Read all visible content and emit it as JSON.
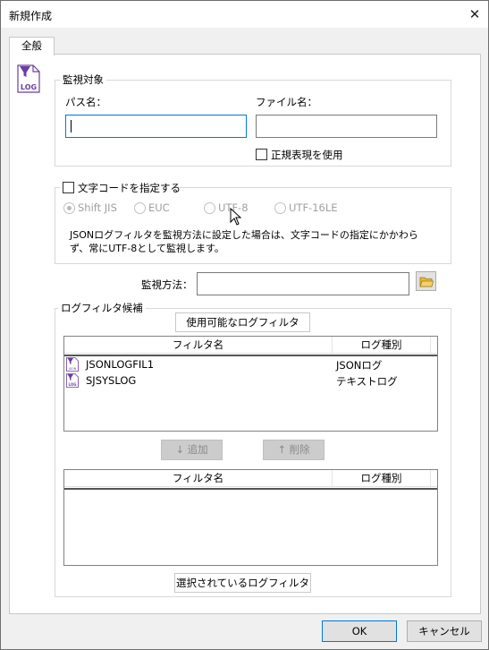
{
  "window": {
    "title": "新規作成",
    "close_glyph": "✕"
  },
  "tabs": [
    {
      "label": "全般"
    }
  ],
  "icon_label": "LOG",
  "small_icon_label": "JSON",
  "monitor_target": {
    "legend": "監視対象",
    "path_label": "パス名：",
    "path_value": "",
    "file_label": "ファイル名：",
    "file_value": "",
    "regex_label": "正規表現を使用",
    "regex_checked": false
  },
  "encoding": {
    "checkbox_label": "文字コードを指定する",
    "checked": false,
    "options": [
      "Shift JIS",
      "EUC",
      "UTF-8",
      "UTF-16LE"
    ],
    "selected": "Shift JIS",
    "note": "JSONログフィルタを監視方法に設定した場合は、文字コードの指定にかかわらず、常にUTF-8として監視します。"
  },
  "method": {
    "label": "監視方法：",
    "value": "",
    "browse_icon": "folder-icon"
  },
  "log_filter": {
    "legend": "ログフィルタ候補",
    "available_tab": "使用可能なログフィルタ",
    "selected_tab": "選択されているログフィルタ",
    "columns": [
      "フィルタ名",
      "ログ種別"
    ],
    "available_rows": [
      {
        "name": "JSONLOGFIL1",
        "type": "JSONログ"
      },
      {
        "name": "SJSYSLOG",
        "type": "テキストログ"
      }
    ],
    "selected_rows": [],
    "add_button": "↓ 追加",
    "remove_button": "↑ 削除"
  },
  "footer": {
    "ok": "OK",
    "cancel": "キャンセル"
  },
  "colors": {
    "accent": "#0078d7",
    "icon_purple": "#6b3fa0"
  }
}
